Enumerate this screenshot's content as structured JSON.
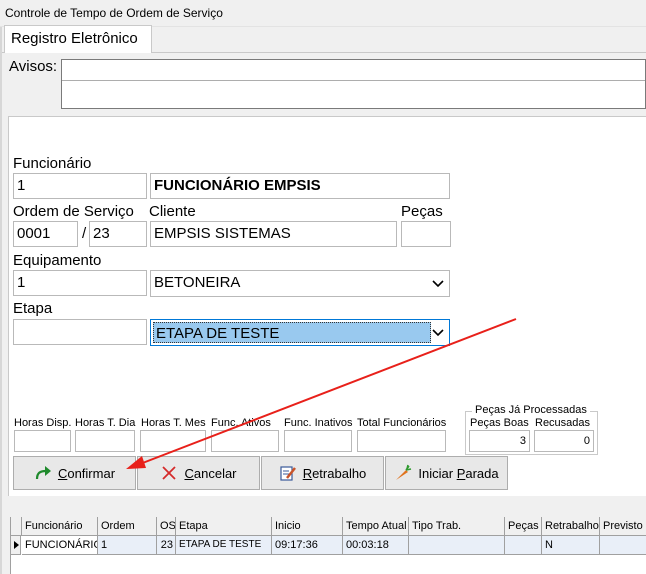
{
  "window": {
    "title": "Controle de Tempo de Ordem de Serviço"
  },
  "tabs": [
    {
      "label": "Registro Eletrônico"
    }
  ],
  "avisos": {
    "label": "Avisos:",
    "value": ""
  },
  "funcionario": {
    "label": "Funcionário",
    "code": "1",
    "name": "FUNCIONÁRIO EMPSIS"
  },
  "ordem": {
    "label": "Ordem de Serviço",
    "os_number": "0001",
    "separator": "/",
    "os_suffix": "23",
    "cliente_label": "Cliente",
    "cliente": "EMPSIS SISTEMAS",
    "pecas_label": "Peças",
    "pecas": ""
  },
  "equipamento": {
    "label": "Equipamento",
    "code": "1",
    "selected": "BETONEIRA"
  },
  "etapa": {
    "label": "Etapa",
    "code": "",
    "selected": "ETAPA DE TESTE"
  },
  "stats": {
    "horas_disp": {
      "label": "Horas Disp.",
      "value": ""
    },
    "horas_dia": {
      "label": "Horas T. Dia",
      "value": ""
    },
    "horas_mes": {
      "label": "Horas T. Mes",
      "value": ""
    },
    "func_ativos": {
      "label": "Func. Ativos",
      "value": ""
    },
    "func_inativos": {
      "label": "Func. Inativos",
      "value": ""
    },
    "total_func": {
      "label": "Total Funcionários",
      "value": ""
    }
  },
  "pecas_processadas": {
    "title": "Peças Já Processadas",
    "boas_label": "Peças Boas",
    "boas": "3",
    "recusadas_label": "Recusadas",
    "recusadas": "0"
  },
  "buttons": {
    "confirmar": {
      "prefix": "C",
      "rest": "onfirmar"
    },
    "cancelar": {
      "prefix": "C",
      "rest": "ancelar"
    },
    "retrabalho": {
      "prefix": "R",
      "rest": "etrabalho"
    },
    "parada_a": "Iniciar ",
    "parada_u": "P",
    "parada_b": "arada"
  },
  "grid": {
    "headers": [
      "Funcionário",
      "Ordem",
      "OS",
      "Etapa",
      "Inicio",
      "Tempo Atual",
      "Tipo Trab.",
      "Peças",
      "Retrabalho",
      "Previsto"
    ],
    "rows": [
      [
        "FUNCIONÁRIO EMPSIS",
        "1",
        "23",
        "ETAPA DE TESTE",
        "09:17:36",
        "00:03:18",
        "",
        "",
        "N",
        ""
      ]
    ]
  },
  "colors": {
    "arrow": "#e8201a",
    "selection": "#99c9ef",
    "focus_border": "#0078d7"
  }
}
